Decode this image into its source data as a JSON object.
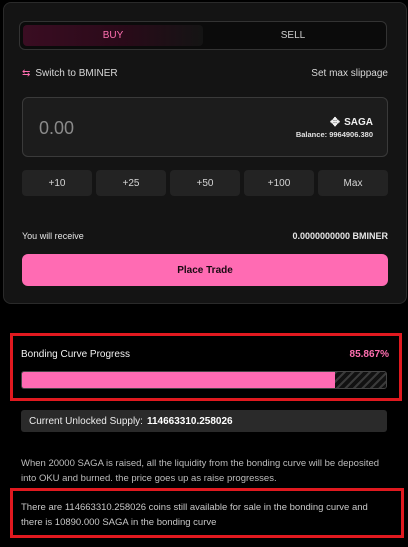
{
  "trade": {
    "tabs": {
      "buy": "BUY",
      "sell": "SELL"
    },
    "switch_label": "Switch to BMINER",
    "switch_icon": "swap-icon",
    "slippage_label": "Set max slippage",
    "amount_placeholder": "0.00",
    "token": {
      "symbol": "SAGA",
      "icon": "saga-token-icon",
      "balance": "Balance: 9964906.380"
    },
    "quick_amounts": [
      "+10",
      "+25",
      "+50",
      "+100",
      "Max"
    ],
    "receive_label": "You will receive",
    "receive_value": "0.0000000000 BMINER",
    "place_trade": "Place Trade"
  },
  "bonding": {
    "title": "Bonding Curve Progress",
    "percent_text": "85.867%",
    "progress_fraction": 0.85867,
    "supply_label": "Current Unlocked Supply:",
    "supply_value": "114663310.258026",
    "info_text": "When 20000 SAGA is raised, all the liquidity from the bonding curve will be deposited into OKU and burned. the price goes up as raise progresses.",
    "remaining_text": "There are 114663310.258026 coins still available for sale in the bonding curve and there is 10890.000 SAGA in the bonding curve"
  },
  "colors": {
    "accent": "#ff6bb3",
    "highlight_border": "#e0191f",
    "background": "#000000"
  }
}
